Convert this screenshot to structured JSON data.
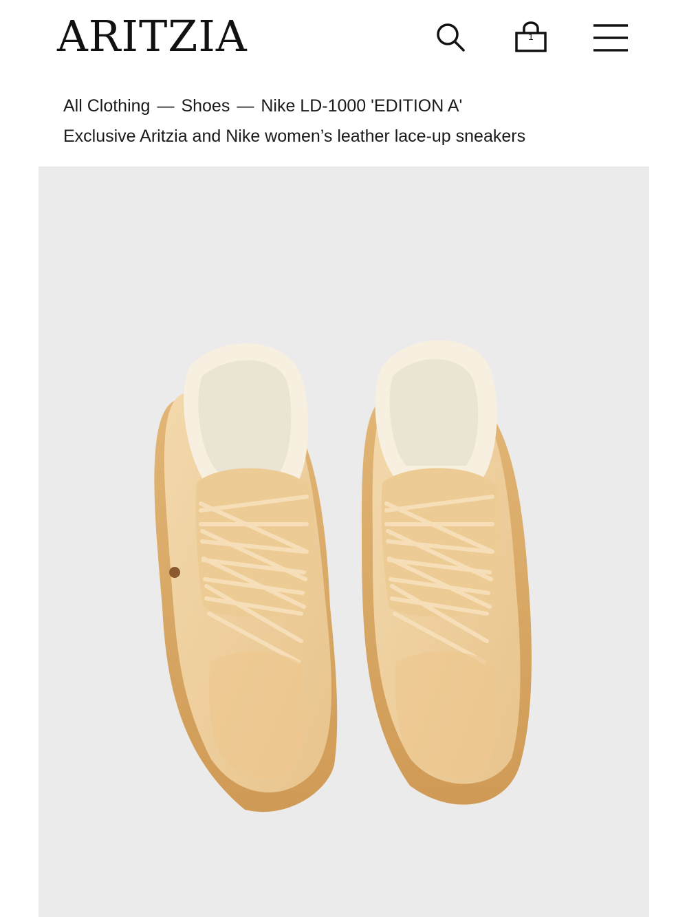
{
  "header": {
    "brand": "ARITZIA",
    "search_icon": "search-icon",
    "bag_icon": "shopping-bag-icon",
    "bag_count": "1",
    "menu_icon": "hamburger-menu-icon"
  },
  "breadcrumb": {
    "items": [
      "All Clothing",
      "Shoes",
      "Nike LD-1000 'EDITION A'"
    ],
    "separator": "—"
  },
  "product": {
    "subtitle": "Exclusive Aritzia and Nike women’s leather lace-up sneakers",
    "image_alt": "Nike LD-1000 sneakers in tan leather, top view"
  },
  "colors": {
    "background": "#ebebeb",
    "leather": "#f0d2a1",
    "text": "#111111"
  }
}
